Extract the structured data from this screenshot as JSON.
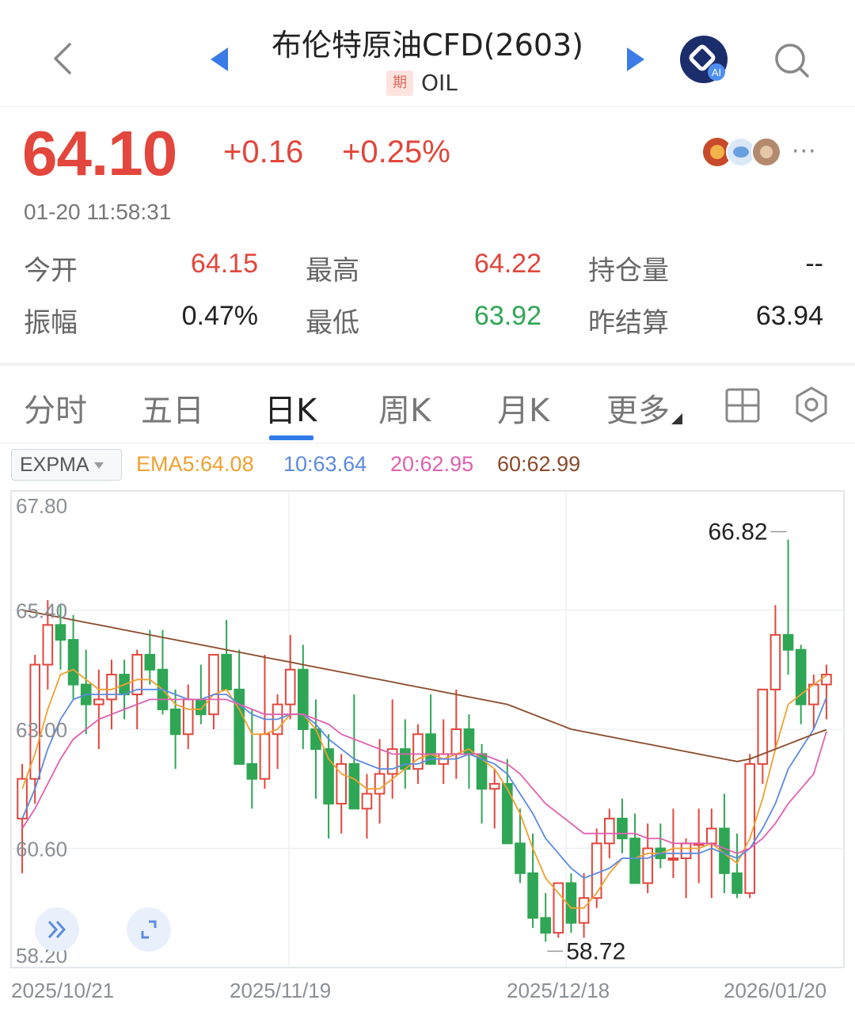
{
  "header": {
    "title": "布伦特原油CFD(2603)",
    "badge": "期",
    "code": "OIL",
    "ai_label": "AI"
  },
  "quote": {
    "price": "64.10",
    "change": "+0.16",
    "change_pct": "+0.25%",
    "timestamp": "01-20 11:58:31",
    "more": "···"
  },
  "stats": {
    "open_label": "今开",
    "open_value": "64.15",
    "high_label": "最高",
    "high_value": "64.22",
    "oi_label": "持仓量",
    "oi_value": "--",
    "amp_label": "振幅",
    "amp_value": "0.47%",
    "low_label": "最低",
    "low_value": "63.92",
    "settle_label": "昨结算",
    "settle_value": "63.94"
  },
  "tabs": [
    "分时",
    "五日",
    "日K",
    "周K",
    "月K",
    "更多"
  ],
  "active_tab": "日K",
  "indicator": {
    "name": "EXPMA",
    "ema5": "EMA5:64.08",
    "ema10": "10:63.64",
    "ema20": "20:62.95",
    "ema60": "60:62.99"
  },
  "colors": {
    "up": "#e2463c",
    "down": "#2fa655",
    "ema5": "#f0a030",
    "ema10": "#5b8be0",
    "ema20": "#e060b0",
    "ema60": "#8a4a2a",
    "accent": "#2f7be6"
  },
  "chart_data": {
    "type": "candlestick",
    "y_ticks": [
      "67.80",
      "65.40",
      "63.00",
      "60.60",
      "58.20"
    ],
    "ylim": [
      58.2,
      67.8
    ],
    "x_ticks": [
      "2025/10/21",
      "2025/11/19",
      "2025/12/18",
      "2026/01/20"
    ],
    "max_label": "66.82",
    "min_label": "58.72",
    "candles": [
      [
        61.2,
        62.3,
        60.1,
        62.0
      ],
      [
        62.0,
        64.5,
        61.5,
        64.3
      ],
      [
        64.3,
        65.6,
        63.8,
        65.1
      ],
      [
        65.1,
        65.5,
        64.2,
        64.8
      ],
      [
        64.8,
        65.3,
        63.6,
        63.9
      ],
      [
        63.9,
        64.6,
        62.9,
        63.5
      ],
      [
        63.5,
        64.2,
        62.6,
        63.6
      ],
      [
        63.6,
        64.4,
        63.0,
        64.1
      ],
      [
        64.1,
        64.4,
        63.2,
        63.7
      ],
      [
        63.7,
        64.6,
        63.0,
        64.5
      ],
      [
        64.5,
        65.0,
        63.9,
        64.2
      ],
      [
        64.2,
        65.0,
        63.3,
        63.4
      ],
      [
        63.4,
        63.8,
        62.2,
        62.9
      ],
      [
        62.9,
        63.9,
        62.6,
        63.6
      ],
      [
        63.6,
        64.3,
        63.1,
        63.3
      ],
      [
        63.3,
        64.4,
        63.0,
        64.5
      ],
      [
        64.5,
        65.2,
        63.8,
        63.8
      ],
      [
        63.8,
        64.6,
        62.7,
        62.3
      ],
      [
        62.3,
        63.4,
        61.4,
        62.0
      ],
      [
        62.0,
        64.5,
        61.8,
        62.9
      ],
      [
        62.9,
        63.7,
        62.2,
        63.5
      ],
      [
        63.5,
        64.9,
        63.2,
        64.2
      ],
      [
        64.2,
        64.7,
        62.6,
        63.0
      ],
      [
        63.0,
        63.6,
        61.6,
        62.6
      ],
      [
        62.6,
        62.9,
        60.8,
        61.5
      ],
      [
        61.5,
        62.5,
        60.9,
        62.3
      ],
      [
        62.3,
        63.7,
        61.7,
        61.4
      ],
      [
        61.4,
        62.1,
        60.8,
        61.7
      ],
      [
        61.7,
        62.8,
        61.1,
        62.1
      ],
      [
        62.1,
        63.6,
        61.6,
        62.6
      ],
      [
        62.6,
        63.2,
        61.8,
        62.2
      ],
      [
        62.2,
        63.1,
        61.9,
        62.9
      ],
      [
        62.9,
        63.7,
        62.3,
        62.3
      ],
      [
        62.3,
        63.2,
        61.9,
        62.5
      ],
      [
        62.5,
        63.8,
        62.0,
        63.0
      ],
      [
        63.0,
        63.3,
        61.8,
        62.5
      ],
      [
        62.5,
        62.7,
        61.1,
        61.8
      ],
      [
        61.8,
        62.2,
        61.0,
        61.9
      ],
      [
        61.9,
        62.4,
        61.0,
        60.7
      ],
      [
        60.7,
        61.4,
        59.9,
        60.1
      ],
      [
        60.1,
        60.9,
        59.0,
        59.2
      ],
      [
        59.2,
        59.7,
        58.72,
        58.9
      ],
      [
        58.9,
        59.9,
        58.8,
        59.9
      ],
      [
        59.9,
        60.1,
        58.9,
        59.1
      ],
      [
        59.1,
        60.1,
        58.8,
        59.6
      ],
      [
        59.6,
        61.0,
        59.4,
        60.7
      ],
      [
        60.7,
        61.4,
        60.4,
        61.2
      ],
      [
        61.2,
        61.6,
        60.5,
        60.8
      ],
      [
        60.8,
        61.3,
        60.1,
        59.9
      ],
      [
        59.9,
        61.1,
        59.7,
        60.6
      ],
      [
        60.6,
        61.1,
        60.2,
        60.4
      ],
      [
        60.4,
        61.4,
        60.0,
        60.4
      ],
      [
        60.4,
        60.8,
        59.6,
        60.7
      ],
      [
        60.7,
        61.4,
        59.9,
        60.7
      ],
      [
        60.7,
        61.4,
        59.6,
        61.0
      ],
      [
        61.0,
        61.7,
        59.7,
        60.1
      ],
      [
        60.1,
        60.9,
        59.6,
        59.7
      ],
      [
        59.7,
        62.5,
        59.6,
        62.3
      ],
      [
        62.3,
        63.7,
        61.9,
        63.8
      ],
      [
        63.8,
        65.5,
        62.6,
        64.9
      ],
      [
        64.9,
        66.82,
        64.1,
        64.6
      ],
      [
        64.6,
        64.7,
        63.1,
        63.5
      ],
      [
        63.5,
        64.1,
        63.0,
        63.9
      ],
      [
        63.9,
        64.3,
        63.2,
        64.1
      ]
    ],
    "ema_series": {
      "ema5": [
        61.8,
        62.5,
        63.4,
        64.1,
        64.2,
        64.0,
        63.8,
        63.8,
        63.9,
        64.0,
        64.0,
        63.8,
        63.5,
        63.4,
        63.4,
        63.7,
        63.8,
        63.4,
        62.9,
        62.9,
        63.0,
        63.3,
        63.3,
        63.0,
        62.4,
        62.1,
        62.0,
        61.8,
        61.8,
        62.0,
        62.2,
        62.4,
        62.5,
        62.4,
        62.5,
        62.6,
        62.4,
        62.2,
        61.8,
        61.3,
        60.6,
        60.0,
        59.7,
        59.4,
        59.4,
        59.7,
        60.1,
        60.4,
        60.4,
        60.5,
        60.5,
        60.6,
        60.6,
        60.6,
        60.7,
        60.5,
        60.3,
        60.8,
        61.6,
        62.6,
        63.5,
        63.7,
        63.9,
        64.08
      ],
      "ema10": [
        61.2,
        61.8,
        62.6,
        63.2,
        63.6,
        63.7,
        63.7,
        63.7,
        63.7,
        63.8,
        63.8,
        63.8,
        63.7,
        63.6,
        63.6,
        63.7,
        63.7,
        63.5,
        63.3,
        63.2,
        63.2,
        63.3,
        63.3,
        63.1,
        62.8,
        62.6,
        62.4,
        62.3,
        62.2,
        62.2,
        62.3,
        62.3,
        62.4,
        62.4,
        62.4,
        62.5,
        62.4,
        62.3,
        62.1,
        61.7,
        61.3,
        60.8,
        60.5,
        60.2,
        60.0,
        60.1,
        60.2,
        60.4,
        60.4,
        60.4,
        60.5,
        60.5,
        60.5,
        60.5,
        60.6,
        60.5,
        60.4,
        60.6,
        61.0,
        61.5,
        62.2,
        62.6,
        63.0,
        63.64
      ],
      "ema20": [
        61.0,
        61.4,
        61.9,
        62.4,
        62.8,
        63.0,
        63.2,
        63.3,
        63.4,
        63.5,
        63.6,
        63.6,
        63.6,
        63.6,
        63.6,
        63.6,
        63.6,
        63.5,
        63.4,
        63.3,
        63.3,
        63.3,
        63.3,
        63.2,
        63.1,
        62.9,
        62.8,
        62.7,
        62.6,
        62.5,
        62.5,
        62.5,
        62.5,
        62.5,
        62.5,
        62.5,
        62.5,
        62.4,
        62.3,
        62.1,
        61.8,
        61.5,
        61.3,
        61.1,
        60.9,
        60.9,
        60.9,
        60.9,
        60.9,
        60.8,
        60.8,
        60.7,
        60.7,
        60.7,
        60.7,
        60.6,
        60.5,
        60.6,
        60.8,
        61.1,
        61.5,
        61.8,
        62.1,
        62.95
      ],
      "ema60": [
        65.4,
        65.35,
        65.3,
        65.25,
        65.2,
        65.15,
        65.1,
        65.05,
        65.0,
        64.95,
        64.9,
        64.85,
        64.8,
        64.75,
        64.7,
        64.65,
        64.6,
        64.55,
        64.5,
        64.45,
        64.4,
        64.35,
        64.3,
        64.25,
        64.2,
        64.15,
        64.1,
        64.05,
        64.0,
        63.95,
        63.9,
        63.85,
        63.8,
        63.75,
        63.7,
        63.65,
        63.6,
        63.55,
        63.5,
        63.4,
        63.3,
        63.2,
        63.1,
        63.0,
        62.95,
        62.9,
        62.85,
        62.8,
        62.75,
        62.7,
        62.65,
        62.6,
        62.55,
        62.5,
        62.45,
        62.4,
        62.35,
        62.4,
        62.5,
        62.6,
        62.7,
        62.8,
        62.9,
        62.99
      ]
    }
  }
}
